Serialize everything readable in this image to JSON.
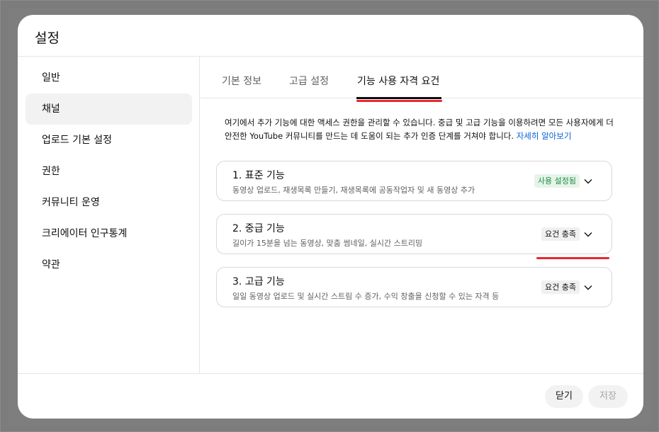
{
  "dialog": {
    "title": "설정"
  },
  "sidebar": {
    "items": [
      {
        "label": "일반",
        "active": false
      },
      {
        "label": "채널",
        "active": true
      },
      {
        "label": "업로드 기본 설정",
        "active": false
      },
      {
        "label": "권한",
        "active": false
      },
      {
        "label": "커뮤니티 운영",
        "active": false
      },
      {
        "label": "크리에이터 인구통계",
        "active": false
      },
      {
        "label": "약관",
        "active": false
      }
    ]
  },
  "tabs": [
    {
      "label": "기본 정보",
      "active": false
    },
    {
      "label": "고급 설정",
      "active": false
    },
    {
      "label": "기능 사용 자격 요건",
      "active": true
    }
  ],
  "description": {
    "text": "여기에서 추가 기능에 대한 액세스 권한을 관리할 수 있습니다. 중급 및 고급 기능을 이용하려면 모든 사용자에게 더 안전한 YouTube 커뮤니티를 만드는 데 도움이 되는 추가 인증 단계를 거쳐야 합니다. ",
    "link": "자세히 알아보기"
  },
  "features": [
    {
      "title": "1. 표준 기능",
      "desc": "동영상 업로드, 재생목록 만들기, 재생목록에 공동작업자 및 새 동영상 추가",
      "badge": "사용 설정됨",
      "badge_style": "green"
    },
    {
      "title": "2. 중급 기능",
      "desc": "길이가 15분을 넘는 동영상, 맞춤 썸네일, 실시간 스트리밍",
      "badge": "요건 충족",
      "badge_style": "gray"
    },
    {
      "title": "3. 고급 기능",
      "desc": "일일 동영상 업로드 및 실시간 스트림 수 증가, 수익 창출을 신청할 수 있는 자격 등",
      "badge": "요건 충족",
      "badge_style": "gray"
    }
  ],
  "footer": {
    "close_label": "닫기",
    "save_label": "저장"
  },
  "colors": {
    "annotation": "#e8262f",
    "link": "#065fd4",
    "badge_green_bg": "#e6f4ea",
    "badge_green_text": "#1e8e3e"
  }
}
